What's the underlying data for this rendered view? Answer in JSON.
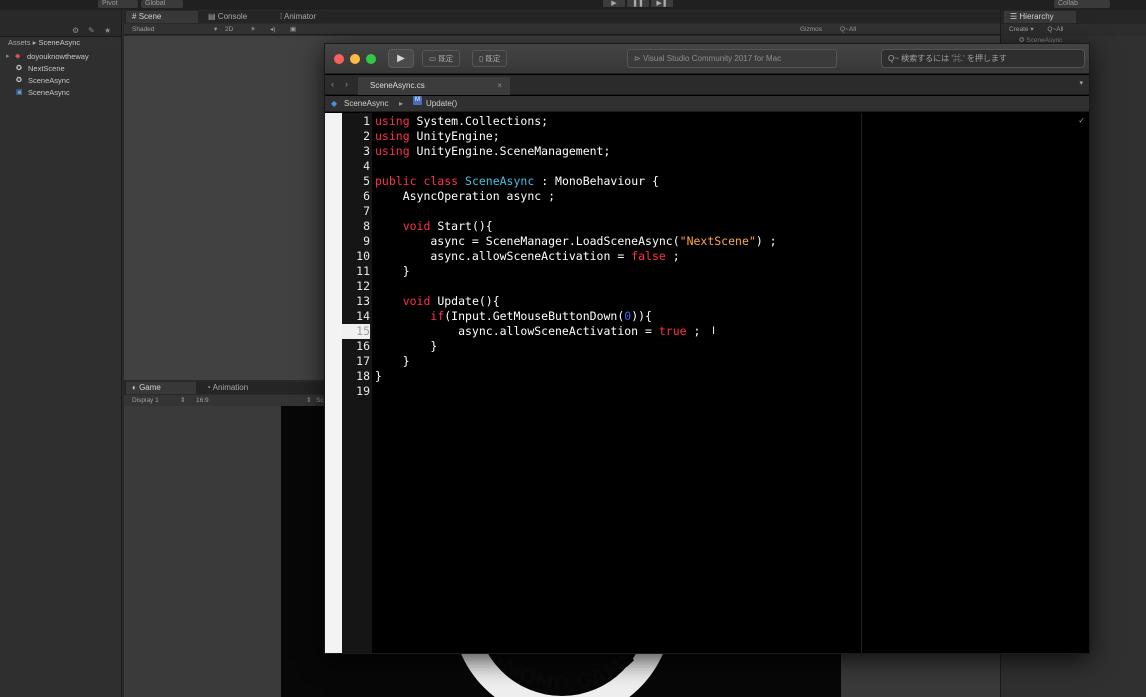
{
  "unity": {
    "toolbar": {
      "pivot": "Pivot",
      "global": "Global",
      "collab": "Collab"
    },
    "scene_tabs": [
      {
        "label": "Scene"
      },
      {
        "label": "Console"
      },
      {
        "label": "Animator"
      }
    ],
    "scene_toolbar": {
      "shading": "Shaded",
      "mode_2d": "2D",
      "gizmos": "Gizmos",
      "search_placeholder": "All"
    },
    "game_tabs": [
      {
        "label": "Game"
      },
      {
        "label": "Animation"
      }
    ],
    "game_toolbar": {
      "display": "Display 1",
      "aspect": "16:9",
      "scale": "Sc"
    },
    "project": {
      "breadcrumb_root": "Assets",
      "breadcrumb_current": "SceneAsync",
      "items": [
        {
          "label": "doyouknowtheway",
          "icon": "folder-icon"
        },
        {
          "label": "NextScene",
          "icon": "unity-scene-icon"
        },
        {
          "label": "SceneAsync",
          "icon": "unity-scene-icon"
        },
        {
          "label": "SceneAsync",
          "icon": "csharp-script-icon"
        }
      ]
    },
    "hierarchy": {
      "tab": "Hierarchy",
      "create": "Create",
      "search_placeholder": "All",
      "row": "SceneAsync"
    },
    "logo_text": "SMOMO GAME"
  },
  "vs": {
    "status_text": "Visual Studio Community 2017 for Mac",
    "search_placeholder": "検索するには '⌘.' を押します",
    "config_1": "既定",
    "config_2": "既定",
    "document_tab": "SceneAsync.cs",
    "path_class": "SceneAsync",
    "path_method": "Update()",
    "current_line": 15,
    "line_numbers": [
      "1",
      "2",
      "3",
      "4",
      "5",
      "6",
      "7",
      "8",
      "9",
      "10",
      "11",
      "12",
      "13",
      "14",
      "15",
      "16",
      "17",
      "18",
      "19"
    ],
    "code": {
      "l1_kw": "using",
      "l1_rest": " System.Collections;",
      "l2_kw": "using",
      "l2_rest": " UnityEngine;",
      "l3_kw": "using",
      "l3_rest": " UnityEngine.SceneManagement;",
      "l5_kw": "public class",
      "l5_type": " SceneAsync",
      "l5_rest": " : MonoBehaviour {",
      "l6": "    AsyncOperation async ;",
      "l8_indent": "    ",
      "l8_kw": "void",
      "l8_rest": " Start(){",
      "l9_pre": "        async = SceneManager.LoadSceneAsync(",
      "l9_str": "\"NextScene\"",
      "l9_post": ") ;",
      "l10_pre": "        async.allowSceneActivation = ",
      "l10_kw": "false",
      "l10_post": " ;",
      "l11": "    }",
      "l13_indent": "    ",
      "l13_kw": "void",
      "l13_rest": " Update(){",
      "l14_indent": "        ",
      "l14_kw": "if",
      "l14_pre": "(Input.GetMouseButtonDown(",
      "l14_num": "0",
      "l14_post": ")){",
      "l15_pre": "            async.allowSceneActivation = ",
      "l15_kw": "true",
      "l15_post": " ;",
      "l16": "        }",
      "l17": "    }",
      "l18": "}"
    }
  }
}
